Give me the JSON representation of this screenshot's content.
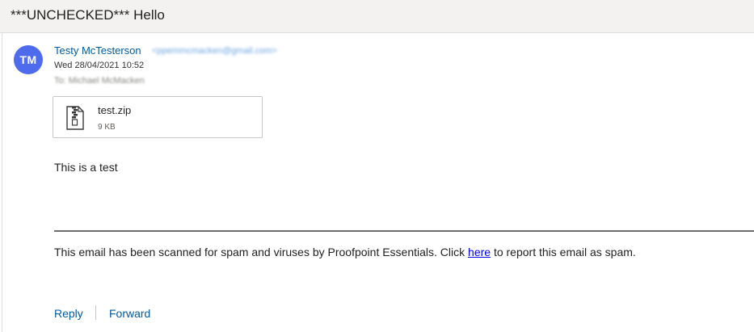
{
  "subject": "***UNCHECKED*** Hello",
  "sender": {
    "initials": "TM",
    "avatar_color": "#4f6bed",
    "name": "Testy McTesterson",
    "email": "<ppemmcmacken@gmail.com>",
    "date": "Wed 28/04/2021 10:52",
    "to_line": "To: Michael McMacken"
  },
  "attachment": {
    "icon": "zip-file-icon",
    "name": "test.zip",
    "size": "9 KB"
  },
  "body": {
    "text": "This is a test"
  },
  "footer": {
    "before_link": "This email has been scanned for spam and viruses by Proofpoint Essentials. Click ",
    "link_text": "here",
    "after_link": " to report this email as spam."
  },
  "actions": {
    "reply": "Reply",
    "forward": "Forward"
  },
  "colors": {
    "link_blue": "#005a9e",
    "hyperlink": "#0000ee"
  }
}
